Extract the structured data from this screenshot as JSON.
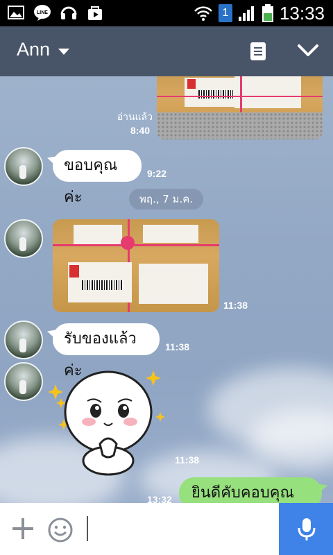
{
  "status_bar": {
    "time": "13:33",
    "sim_indicator": "1",
    "icons": [
      "image-icon",
      "line-icon",
      "headphones-icon",
      "store-icon",
      "wifi-icon",
      "signal-icon",
      "battery-icon"
    ]
  },
  "header": {
    "title": "Ann",
    "icons": [
      "chevron-down-icon",
      "notes-icon",
      "collapse-icon"
    ],
    "color": "#485468"
  },
  "messages": [
    {
      "type": "photo",
      "direction": "out",
      "read_label": "อ่านแล้ว",
      "time": "8:40"
    },
    {
      "type": "text",
      "direction": "in",
      "text": "ขอบคุณค่ะ",
      "time": "9:22"
    },
    {
      "type": "date",
      "text": "พฤ., 7 ม.ค."
    },
    {
      "type": "photo",
      "direction": "in",
      "time": "11:38"
    },
    {
      "type": "text",
      "direction": "in",
      "text": "รับของแล้วค่ะ",
      "time": "11:38"
    },
    {
      "type": "sticker",
      "direction": "in",
      "time": "11:38"
    },
    {
      "type": "text",
      "direction": "out",
      "text": "ยินดีคับคอบคุณคับ",
      "time": "13:32"
    }
  ],
  "input_bar": {
    "icons": [
      "plus-icon",
      "emoji-icon",
      "microphone-icon"
    ],
    "mic_color": "#3f82e8"
  },
  "colors": {
    "outgoing_bubble": "#96e07e",
    "incoming_bubble": "#ffffff"
  }
}
